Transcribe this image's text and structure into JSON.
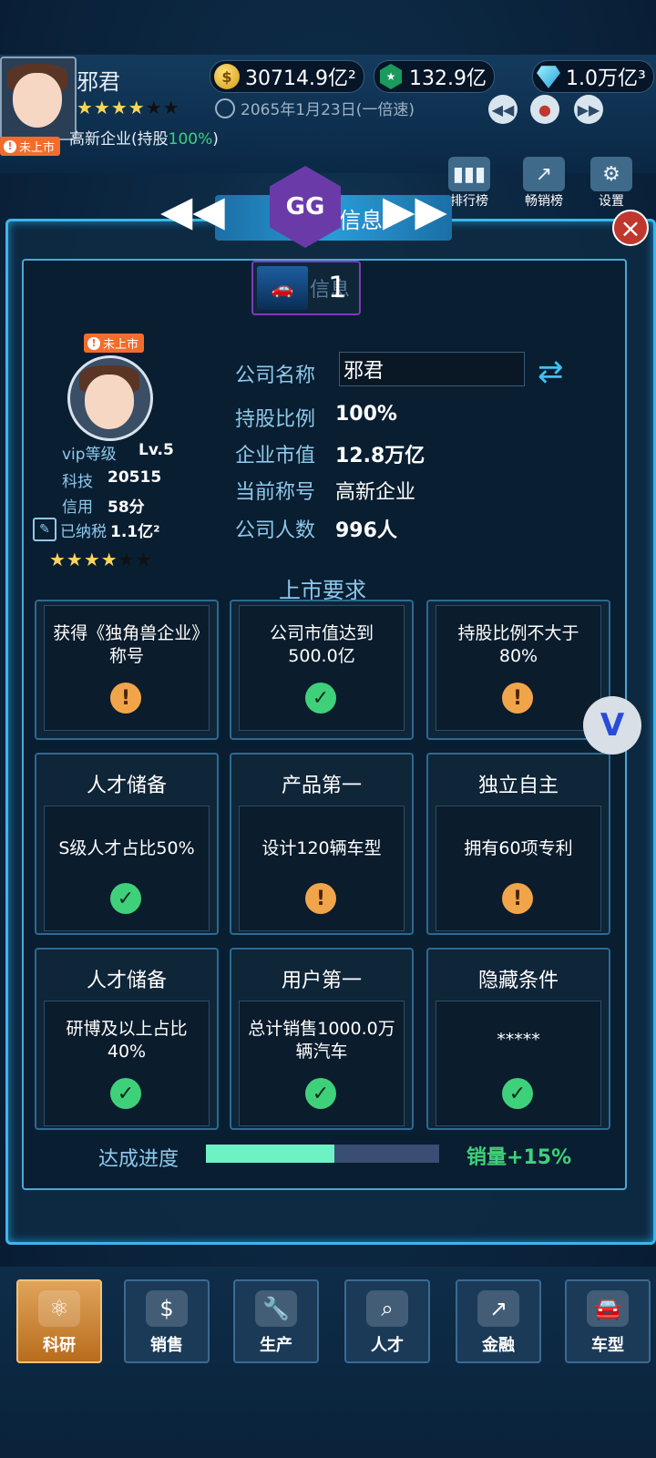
{
  "header": {
    "player_name": "邪君",
    "unlisted_badge": "未上市",
    "company_type": "高新企业(持股",
    "company_share": "100%",
    "company_type_close": ")",
    "date": "2065年1月23日(一倍速)",
    "rating_stars": 4,
    "resources": {
      "gold": "30714.9亿²",
      "green": "132.9亿",
      "diamond": "1.0万亿³"
    },
    "menu": [
      "排行榜",
      "畅销榜",
      "设置"
    ],
    "panel_tab": "信息",
    "gg_label": "GG"
  },
  "panel": {
    "car_card_count": "1",
    "car_card_label": "信息",
    "profile": {
      "unlisted_badge": "未上市",
      "vip_label": "vip等级",
      "vip_value": "Lv.5",
      "tech_label": "科技",
      "tech_value": "20515",
      "credit_label": "信用",
      "credit_value": "58分",
      "tax_label": "已纳税",
      "tax_value": "1.1亿²",
      "stars": 4
    },
    "info": {
      "company_name_label": "公司名称",
      "company_name_value": "邪君",
      "share_label": "持股比例",
      "share_value": "100%",
      "market_value_label": "企业市值",
      "market_value_value": "12.8万亿",
      "title_label": "当前称号",
      "title_value": "高新企业",
      "employees_label": "公司人数",
      "employees_value": "996人"
    },
    "section_title": "上市要求",
    "requirements": [
      {
        "head": "",
        "text": "获得《独角兽企业》称号",
        "status": "warn"
      },
      {
        "head": "",
        "text": "公司市值达到500.0亿",
        "status": "ok"
      },
      {
        "head": "",
        "text": "持股比例不大于80%",
        "status": "warn"
      },
      {
        "head": "人才储备",
        "text": "S级人才占比50%",
        "status": "ok"
      },
      {
        "head": "产品第一",
        "text": "设计120辆车型",
        "status": "warn"
      },
      {
        "head": "独立自主",
        "text": "拥有60项专利",
        "status": "warn"
      },
      {
        "head": "人才储备",
        "text": "研博及以上占比40%",
        "status": "ok"
      },
      {
        "head": "用户第一",
        "text": "总计销售1000.0万辆汽车",
        "status": "ok"
      },
      {
        "head": "隐藏条件",
        "text": "*****",
        "status": "ok"
      }
    ],
    "progress_label": "达成进度",
    "progress_value": 0.55,
    "bonus_label": "销量",
    "bonus_value": "+15%"
  },
  "bottom_nav": {
    "items": [
      {
        "label": "科研",
        "icon": "research-icon"
      },
      {
        "label": "销售",
        "icon": "sales-icon"
      },
      {
        "label": "生产",
        "icon": "production-icon"
      },
      {
        "label": "人才",
        "icon": "talent-icon"
      },
      {
        "label": "金融",
        "icon": "finance-icon"
      },
      {
        "label": "车型",
        "icon": "car-model-icon"
      }
    ],
    "active_index": 0
  },
  "colors": {
    "accent": "#3fb6e8",
    "ok": "#3fd17a",
    "warn": "#f1a54a",
    "unlisted": "#f36c2c",
    "progress": "#6ef2c4"
  }
}
